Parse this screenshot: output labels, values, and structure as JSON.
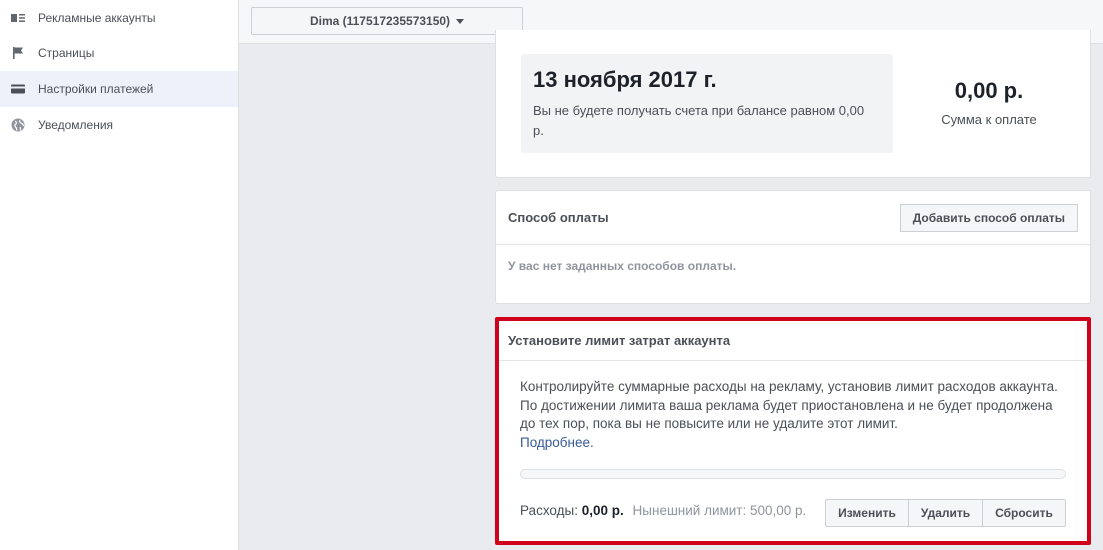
{
  "sidebar": {
    "items": [
      {
        "label": "Рекламные аккаунты",
        "icon": "ad-accounts-icon"
      },
      {
        "label": "Страницы",
        "icon": "flag-icon"
      },
      {
        "label": "Настройки платежей",
        "icon": "credit-card-icon",
        "active": true
      },
      {
        "label": "Уведомления",
        "icon": "globe-icon"
      }
    ]
  },
  "topbar": {
    "account_selector": "Dima (117517235573150)"
  },
  "billing": {
    "date": "13 ноября 2017 г.",
    "note": "Вы не будете получать счета при балансе равном 0,00 р.",
    "amount": "0,00 р.",
    "amount_caption": "Сумма к оплате"
  },
  "payment_method": {
    "title": "Способ оплаты",
    "add_button": "Добавить способ оплаты",
    "empty_text": "У вас нет заданных способов оплаты."
  },
  "spending_limit": {
    "title": "Установите лимит затрат аккаунта",
    "description": "Контролируйте суммарные расходы на рекламу, установив лимит расходов аккаунта. По достижении лимита ваша реклама будет приостановлена и не будет продолжена до тех пор, пока вы не повысите или не удалите этот лимит.",
    "learn_more": "Подробнее.",
    "progress_fraction": 0,
    "spent_label": "Расходы:",
    "spent_value": "0,00 р.",
    "limit_text": "Нынешний лимит: 500,00 р.",
    "buttons": {
      "change": "Изменить",
      "delete": "Удалить",
      "reset": "Сбросить"
    }
  },
  "colors": {
    "highlight_border": "#d0021b",
    "link": "#365899",
    "active_item_bg": "#edf2fa"
  }
}
